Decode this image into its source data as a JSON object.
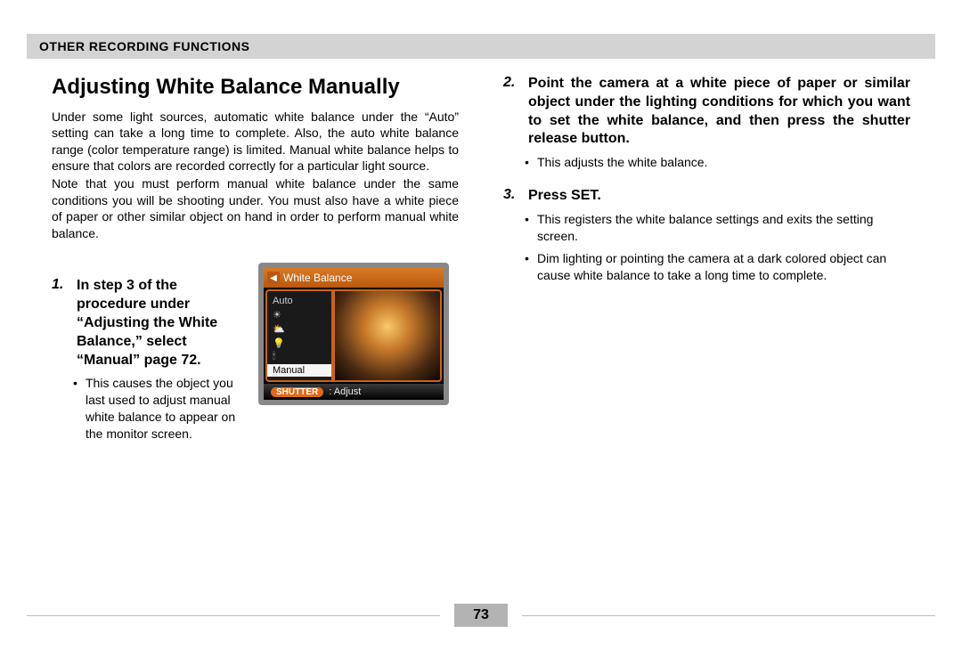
{
  "header": {
    "section": "OTHER RECORDING FUNCTIONS"
  },
  "title": "Adjusting White Balance Manually",
  "intro": [
    "Under some light sources, automatic white balance under the “Auto” setting can take a long time to complete. Also, the auto white balance range (color temperature range) is limited. Manual white balance helps to ensure that colors are recorded correctly for a particular light source.",
    "Note that you must perform manual white balance under the same conditions you will be shooting under. You must also have a white piece of paper or other similar object on hand in order to perform manual white balance."
  ],
  "steps": {
    "s1": {
      "num": "1.",
      "text": "In step 3 of the procedure under “Adjusting the White Balance,” select “Manual” page 72.",
      "sub": "This causes the object you last used to adjust manual white balance to appear on the monitor screen."
    },
    "s2": {
      "num": "2.",
      "text": "Point the camera at a white piece of paper or similar object under the lighting conditions for which you want to set the white balance, and then press the shutter release button.",
      "sub": "This adjusts the white balance."
    },
    "s3": {
      "num": "3.",
      "text": "Press SET.",
      "subs": [
        "This registers the white balance settings and exits the setting screen.",
        "Dim lighting or pointing the camera at a dark colored object can cause white balance to take a long time to complete."
      ]
    }
  },
  "screen": {
    "title": "White Balance",
    "items": [
      "Auto",
      "",
      "",
      "",
      "",
      "Manual"
    ],
    "selected": "Manual",
    "footer_pill": "SHUTTER",
    "footer_text": ": Adjust"
  },
  "page_number": "73"
}
